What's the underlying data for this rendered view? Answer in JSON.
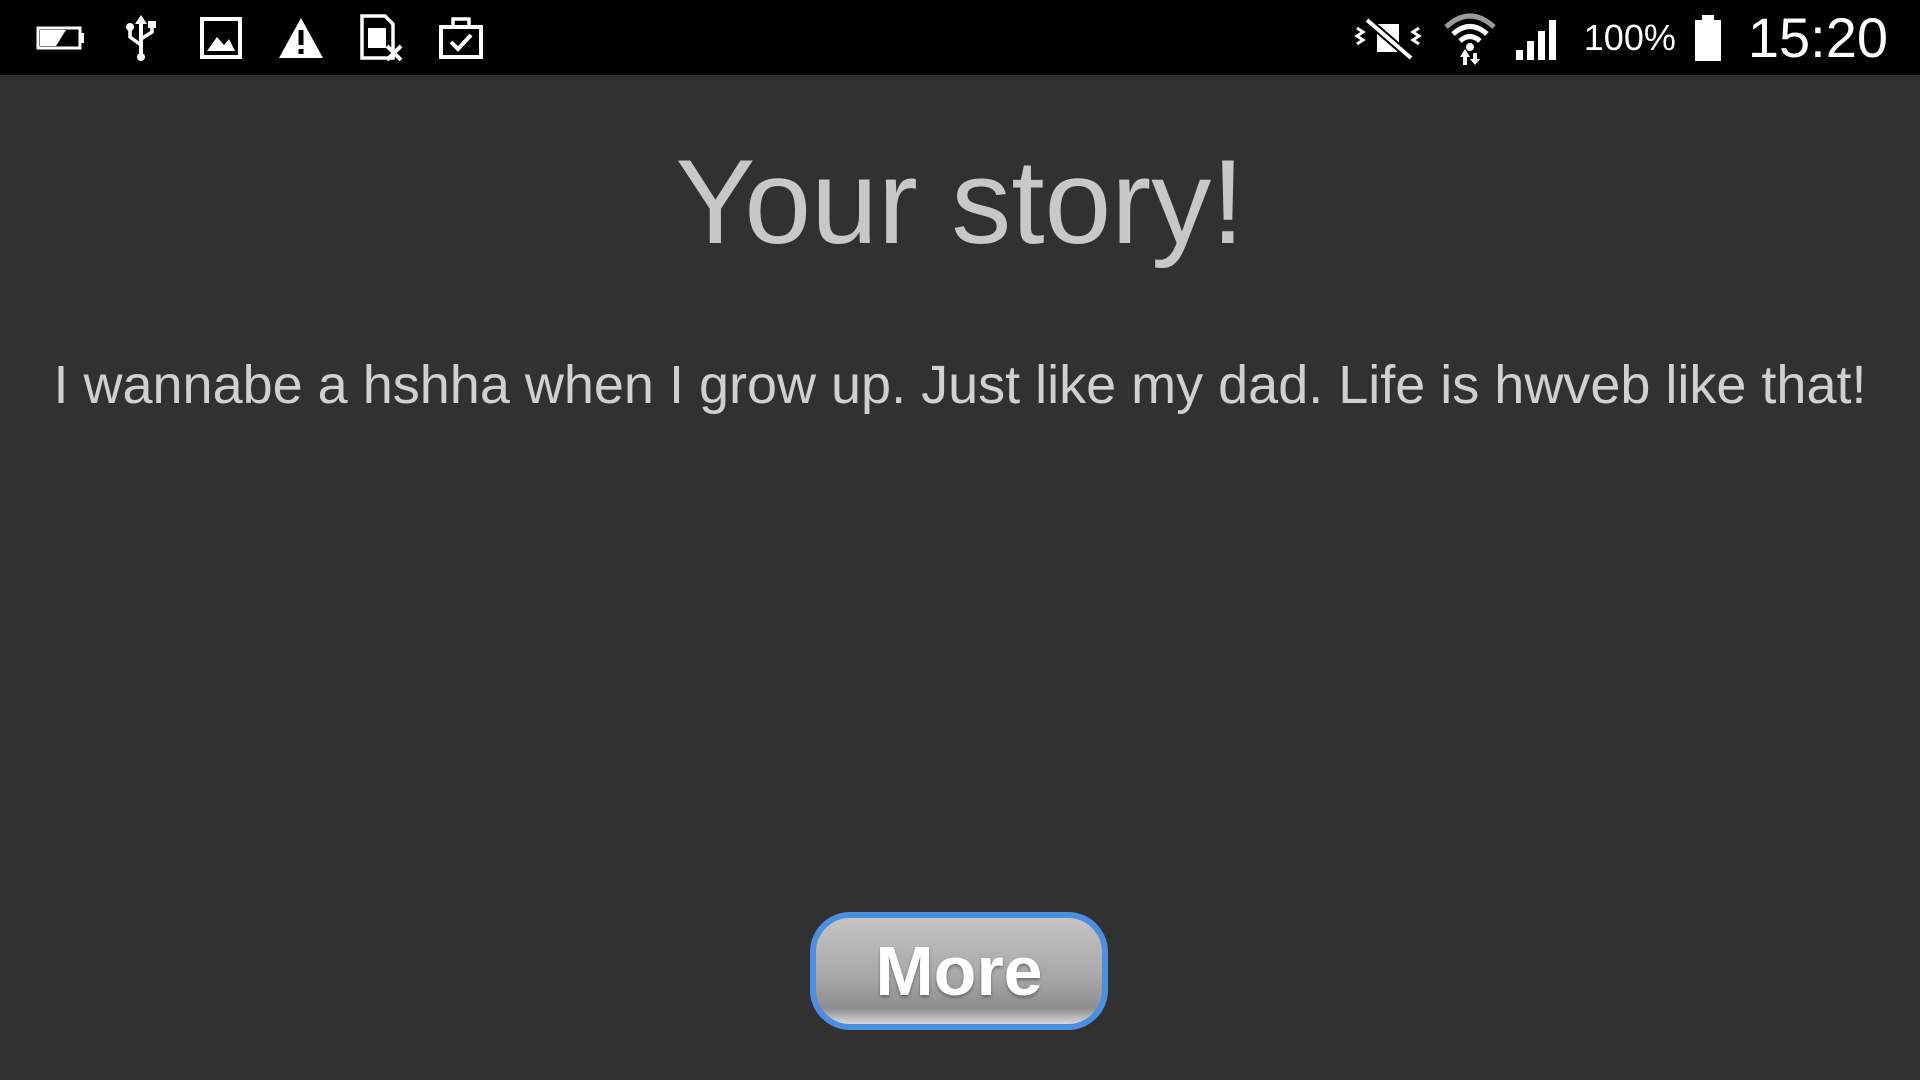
{
  "status_bar": {
    "left_icons": [
      "battery-saver-icon",
      "usb-icon",
      "gallery-icon",
      "warning-icon",
      "sim-card-x-icon",
      "briefcase-check-icon"
    ],
    "right_icons": [
      "mute-icon",
      "wifi-icon",
      "signal-icon",
      "battery-icon"
    ],
    "battery_percent": "100%",
    "time": "15:20"
  },
  "main": {
    "title": "Your story!",
    "story_text": "I wannabe a hshha when I grow up. Just like my dad. Life is hwveb like that!",
    "more_button_label": "More"
  },
  "colors": {
    "background": "#313131",
    "status_bar": "#000000",
    "button_border": "#4b8fe0",
    "title_text": "#c8c8c8"
  }
}
